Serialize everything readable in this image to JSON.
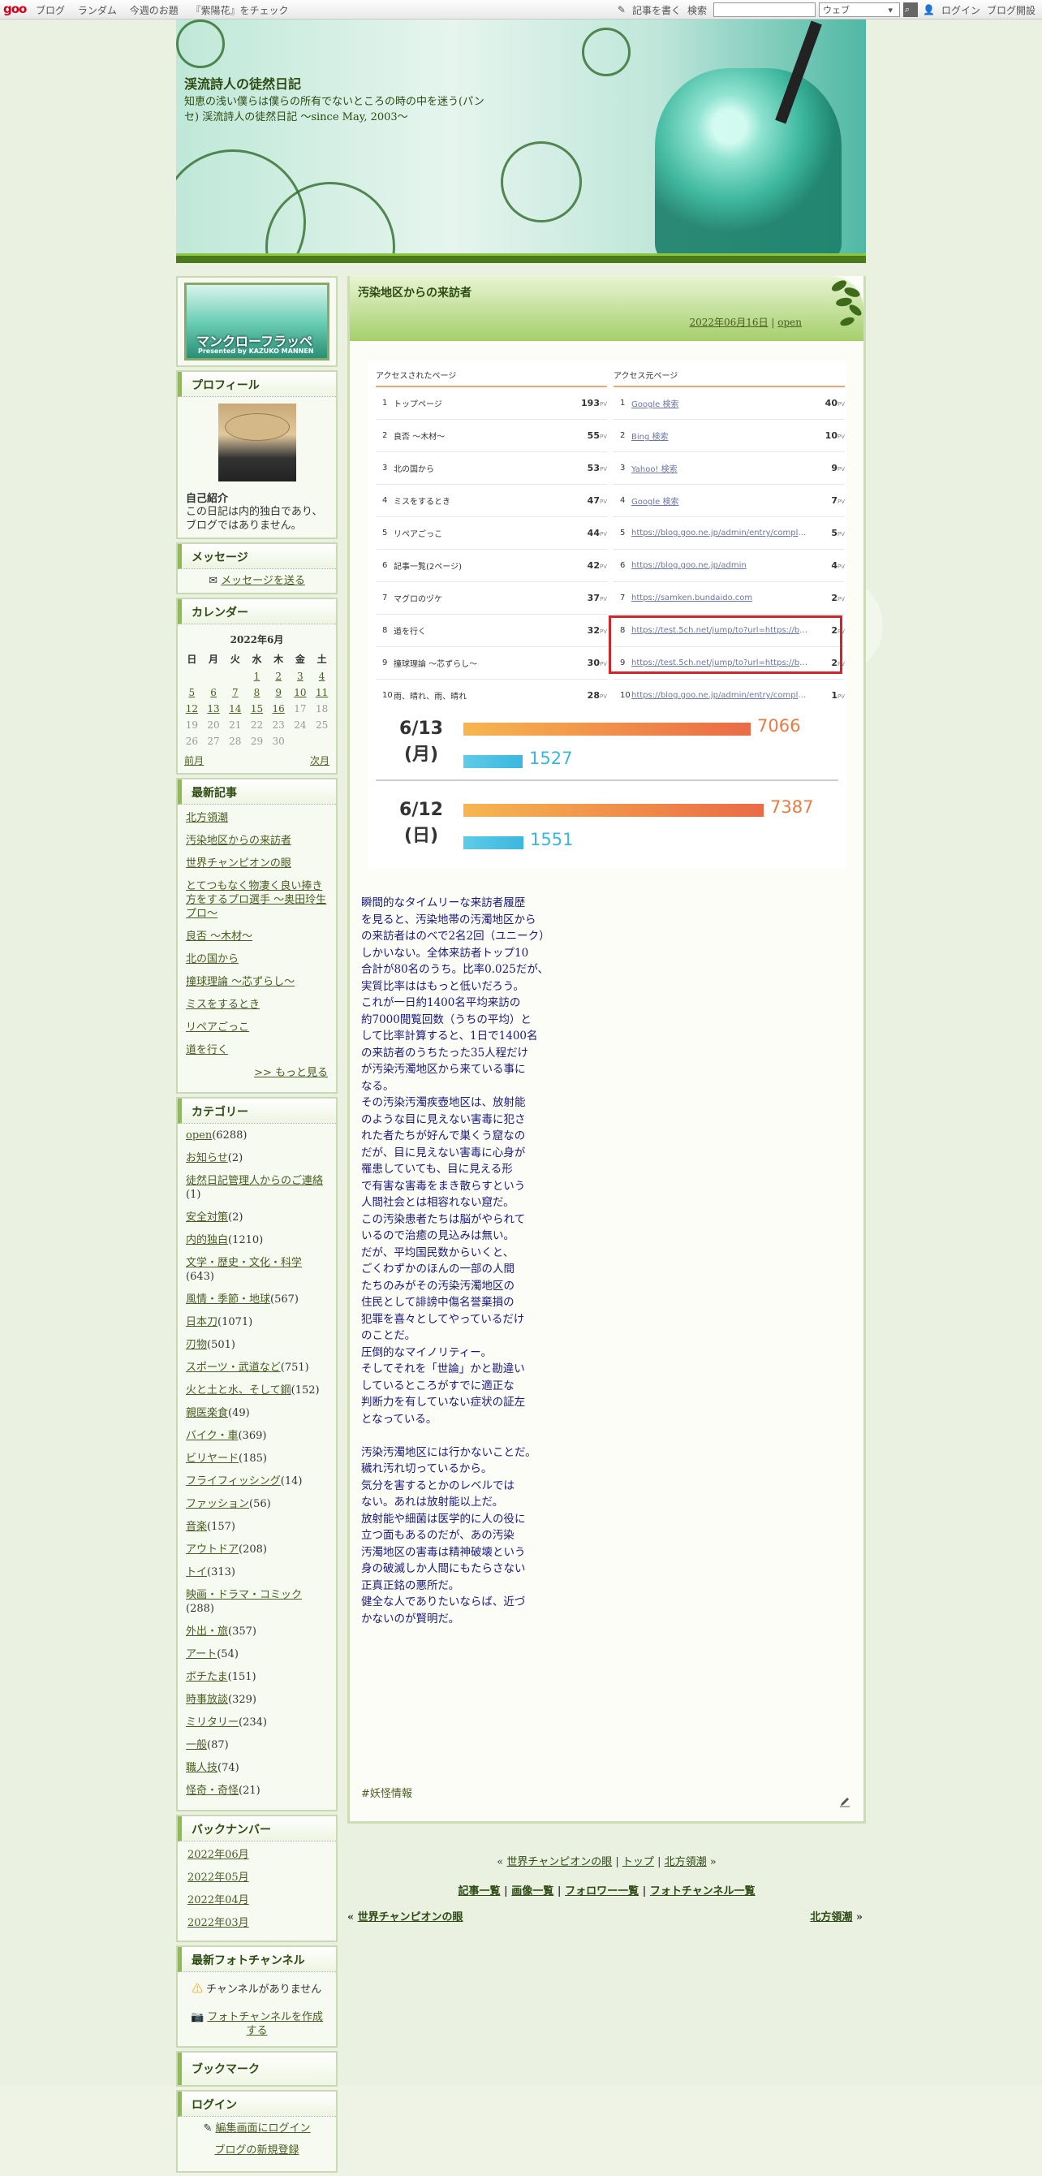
{
  "topbar": {
    "logo": "goo",
    "nav": [
      "ブログ",
      "ランダム",
      "今週のお題",
      "『紫陽花』をチェック"
    ],
    "write": "記事を書く",
    "search_label": "検索",
    "search_select": "ウェブ",
    "login": "ログイン",
    "open_blog": "ブログ開設"
  },
  "header": {
    "title": "渓流詩人の徒然日記",
    "description": "知恵の浅い僕らは僕らの所有でないところの時の中を迷う(パンセ) 渓流詩人の徒然日記 ～since May, 2003～"
  },
  "sidebar": {
    "banner_title": "マンクローフラッペ",
    "banner_sub": "Presented by KAZUKO MANNEN",
    "profile": {
      "heading": "プロフィール",
      "intro_label": "自己紹介",
      "intro_text": "この日記は内的独白であり、ブログではありません。"
    },
    "message": {
      "heading": "メッセージ",
      "link": "メッセージを送る"
    },
    "calendar": {
      "heading": "カレンダー",
      "month": "2022年6月",
      "days": [
        "日",
        "月",
        "火",
        "水",
        "木",
        "金",
        "土"
      ],
      "weeks": [
        [
          "",
          "",
          "",
          "1",
          "2",
          "3",
          "4"
        ],
        [
          "5",
          "6",
          "7",
          "8",
          "9",
          "10",
          "11"
        ],
        [
          "12",
          "13",
          "14",
          "15",
          "16",
          "17",
          "18"
        ],
        [
          "19",
          "20",
          "21",
          "22",
          "23",
          "24",
          "25"
        ],
        [
          "26",
          "27",
          "28",
          "29",
          "30",
          "",
          ""
        ]
      ],
      "prev": "前月",
      "next": "次月"
    },
    "recent": {
      "heading": "最新記事",
      "items": [
        "北方領潮",
        "汚染地区からの来訪者",
        "世界チャンピオンの眼",
        "とてつもなく物凄く良い捧き方をするプロ選手 ～奥田玲生プロ～",
        "良否 ～木材～",
        "北の国から",
        "撞球理論 ～芯ずらし～",
        "ミスをするとき",
        "リペアごっこ",
        "道を行く"
      ],
      "more": ">> もっと見る"
    },
    "category": {
      "heading": "カテゴリー",
      "items": [
        {
          "name": "open",
          "count": "(6288)"
        },
        {
          "name": "お知らせ",
          "count": "(2)"
        },
        {
          "name": "徒然日記管理人からのご連絡",
          "count": "(1)"
        },
        {
          "name": "安全対策",
          "count": "(2)"
        },
        {
          "name": "内的独白",
          "count": "(1210)"
        },
        {
          "name": "文学・歴史・文化・科学",
          "count": "(643)"
        },
        {
          "name": "風情・季節・地球",
          "count": "(567)"
        },
        {
          "name": "日本刀",
          "count": "(1071)"
        },
        {
          "name": "刃物",
          "count": "(501)"
        },
        {
          "name": "スポーツ・武道など",
          "count": "(751)"
        },
        {
          "name": "火と土と水、そして鋼",
          "count": "(152)"
        },
        {
          "name": "親医楽食",
          "count": "(49)"
        },
        {
          "name": "バイク・車",
          "count": "(369)"
        },
        {
          "name": "ビリヤード",
          "count": "(185)"
        },
        {
          "name": "フライフィッシング",
          "count": "(14)"
        },
        {
          "name": "ファッション",
          "count": "(56)"
        },
        {
          "name": "音楽",
          "count": "(157)"
        },
        {
          "name": "アウトドア",
          "count": "(208)"
        },
        {
          "name": "トイ",
          "count": "(313)"
        },
        {
          "name": "映画・ドラマ・コミック",
          "count": "(288)"
        },
        {
          "name": "外出・旅",
          "count": "(357)"
        },
        {
          "name": "アート",
          "count": "(54)"
        },
        {
          "name": "ボチたま",
          "count": "(151)"
        },
        {
          "name": "時事放談",
          "count": "(329)"
        },
        {
          "name": "ミリタリー",
          "count": "(234)"
        },
        {
          "name": "一般",
          "count": "(87)"
        },
        {
          "name": "職人技",
          "count": "(74)"
        },
        {
          "name": "怪奇・奇怪",
          "count": "(21)"
        }
      ]
    },
    "backnumber": {
      "heading": "バックナンバー",
      "items": [
        "2022年06月",
        "2022年05月",
        "2022年04月",
        "2022年03月"
      ]
    },
    "photo": {
      "heading": "最新フォトチャンネル",
      "none": "チャンネルがありません",
      "create": "フォトチャンネルを作成する"
    },
    "bookmark": {
      "heading": "ブックマーク"
    },
    "login": {
      "heading": "ログイン",
      "edit": "編集画面にログイン",
      "new": "ブログの新規登録"
    }
  },
  "post": {
    "title": "汚染地区からの来訪者",
    "date": "2022年06月16日",
    "sep": " | ",
    "category": "open",
    "access": {
      "left_heading": "アクセスされたページ",
      "right_heading": "アクセス元ページ",
      "pv": "PV",
      "left": [
        {
          "n": "1",
          "label": "トップページ",
          "pv": "193"
        },
        {
          "n": "2",
          "label": "良否 ～木材～",
          "pv": "55"
        },
        {
          "n": "3",
          "label": "北の国から",
          "pv": "53"
        },
        {
          "n": "4",
          "label": "ミスをするとき",
          "pv": "47"
        },
        {
          "n": "5",
          "label": "リペアごっこ",
          "pv": "44"
        },
        {
          "n": "6",
          "label": "記事一覧(2ページ)",
          "pv": "42"
        },
        {
          "n": "7",
          "label": "マグロのヅケ",
          "pv": "37"
        },
        {
          "n": "8",
          "label": "道を行く",
          "pv": "32"
        },
        {
          "n": "9",
          "label": "撞球理論 ～芯ずらし～",
          "pv": "30"
        },
        {
          "n": "10",
          "label": "雨、晴れ、雨、晴れ",
          "pv": "28"
        }
      ],
      "right": [
        {
          "n": "1",
          "label": "Google 検索",
          "pv": "40"
        },
        {
          "n": "2",
          "label": "Bing 検索",
          "pv": "10"
        },
        {
          "n": "3",
          "label": "Yahoo! 検索",
          "pv": "9"
        },
        {
          "n": "4",
          "label": "Google 検索",
          "pv": "7"
        },
        {
          "n": "5",
          "label": "https://blog.goo.ne.jp/admin/entry/complete...",
          "pv": "5"
        },
        {
          "n": "6",
          "label": "https://blog.goo.ne.jp/admin",
          "pv": "4"
        },
        {
          "n": "7",
          "label": "https://samken.bundaido.com",
          "pv": "2"
        },
        {
          "n": "8",
          "label": "https://test.5ch.net/jump/to?url=https://blo...",
          "pv": "2"
        },
        {
          "n": "9",
          "label": "https://test.5ch.net/jump/to?url=https://blo...",
          "pv": "2"
        },
        {
          "n": "10",
          "label": "https://blog.goo.ne.jp/admin/entry/complete...",
          "pv": "1"
        }
      ]
    },
    "stats": [
      {
        "date": "6/13",
        "dow": "(月)",
        "pv": 7066,
        "uu": 1527
      },
      {
        "date": "6/12",
        "dow": "(日)",
        "pv": 7387,
        "uu": 1551
      }
    ],
    "body": "瞬間的なタイムリーな来訪者履歴\nを見ると、汚染地帯の汚濁地区から\nの来訪者はのべで2名2回（ユニーク）\nしかいない。全体来訪者トップ10\n合計が80名のうち。比率0.025だが、\n実質比率ははもっと低いだろう。\nこれが一日約1400名平均来訪の\n約7000閲覧回数（うちの平均）と\nして比率計算すると、1日で1400名\nの来訪者のうちたった35人程だけ\nが汚染汚濁地区から来ている事に\nなる。\nその汚染汚濁疾壺地区は、放射能\nのような目に見えない害毒に犯さ\nれた者たちが好んで巣くう窟なの\nだが、目に見えない害毒に心身が\n罹患していても、目に見える形\nで有害な害毒をまき散らすという\n人間社会とは相容れない窟だ。\nこの汚染患者たちは脳がやられて\nいるので治癒の見込みは無い。\nだが、平均国民数からいくと、\nごくわずかのほんの一部の人間\nたちのみがその汚染汚濁地区の\n住民として誹謗中傷名誉棄損の\n犯罪を喜々としてやっているだけ\nのことだ。\n圧倒的なマイノリティー。\nそしてそれを「世論」かと勘違い\nしているところがすでに適正な\n判断力を有していない症状の証左\nとなっている。\n\n汚染汚濁地区には行かないことだ。\n穢れ汚れ切っているから。\n気分を害するとかのレベルでは\nない。あれは放射能以上だ。\n放射能や細菌は医学的に人の役に\n立つ面もあるのだが、あの汚染\n汚濁地区の害毒は精神破壊という\n身の破滅しか人間にもたらさない\n正真正銘の悪所だ。\n健全な人でありたいならば、近づ\nかないのが賢明だ。",
    "tag": "#妖怪情報"
  },
  "pager": {
    "line1_prev": "世界チャンピオンの眼",
    "line1_top": "トップ",
    "line1_next": "北方領潮",
    "line2": [
      "記事一覧",
      "画像一覧",
      "フォロワー一覧",
      "フォトチャンネル一覧"
    ],
    "prev": "世界チャンピオンの眼",
    "next": "北方領潮"
  },
  "colors": {
    "accent": "#8dbd4e",
    "link": "#4a5d23",
    "highlight": "#d0262b"
  }
}
